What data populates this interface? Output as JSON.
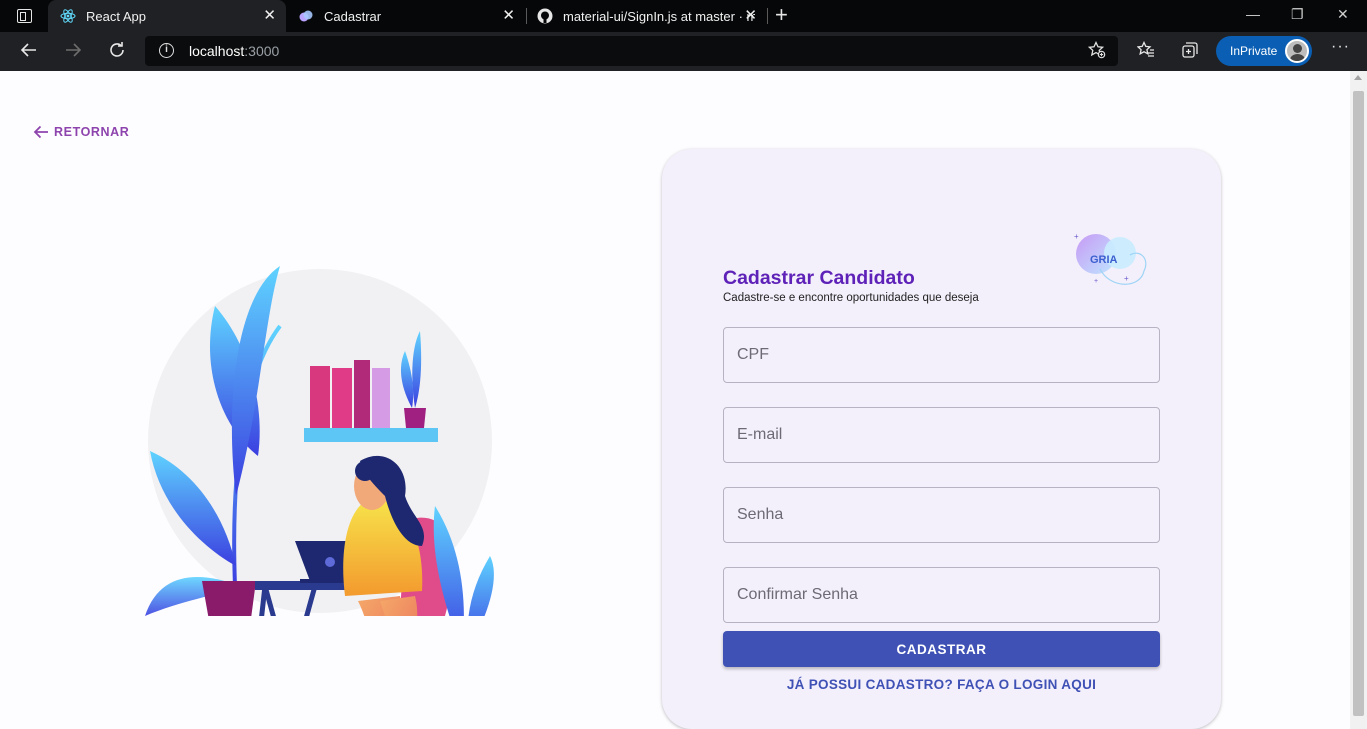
{
  "browser": {
    "tabs": [
      {
        "label": "React App",
        "icon": "react-icon",
        "active": true
      },
      {
        "label": "Cadastrar",
        "icon": "app-icon",
        "active": false
      },
      {
        "label": "material-ui/SignIn.js at master · m",
        "icon": "github-icon",
        "active": false
      }
    ],
    "url_host": "localhost",
    "url_port": ":3000",
    "inprivate_label": "InPrivate"
  },
  "page": {
    "back_label": "RETORNAR",
    "card": {
      "title": "Cadastrar Candidato",
      "subtitle": "Cadastre-se e encontre oportunidades que deseja",
      "logo_text": "GRIA",
      "fields": {
        "cpf": "CPF",
        "email": "E-mail",
        "senha": "Senha",
        "confirmar": "Confirmar Senha"
      },
      "submit_label": "CADASTRAR",
      "login_label": "JÁ POSSUI CADASTRO? FAÇA O LOGIN AQUI"
    }
  },
  "colors": {
    "accent_purple": "#5e22b8",
    "back_link": "#8e44ad",
    "primary_button": "#3f51b5",
    "card_bg": "#f4f0fb"
  }
}
